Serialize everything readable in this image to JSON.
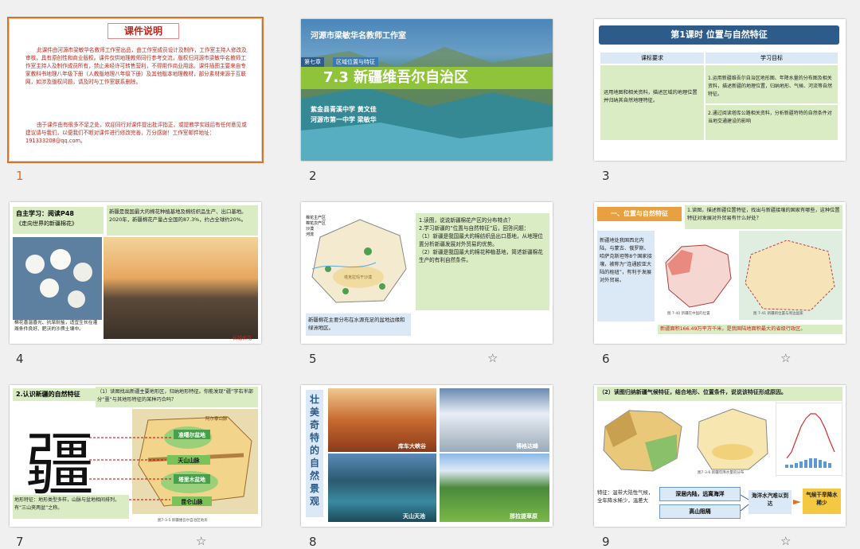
{
  "slides": [
    {
      "number": "1",
      "title": "课件说明",
      "body1": "此课件由河源市梁敏华名教师工作室出品，由工作室成员设计及制作，工作室主持人修改及审核，具有原创性和商业版权。课件仅供地理教师同行参考交流，版权归河源市梁敏华名教师工作室主持人及制作成员所有，禁止未经许可转售营利，不得用作商业用途。课件插图主要来自专家教科书地理八年级下册（人教版地理八年级下册）及其他版本地理教材，部分素材来源于互联网，如涉及版权问题，请及时与工作室联系删除。",
      "body2": "由于课件由有很多不足之处，欢迎同行对课件提出批评指正，或提教学实践后有任何意见或建议请与我们，以便我们不断对课件进行修改完善，万分感谢！工作室邮件地址：191333208@qq.com。"
    },
    {
      "number": "2",
      "studio": "河源市梁敏华名教师工作室",
      "chapter": "第七章",
      "section": "区域位置与特征",
      "title": "7.3 新疆维吾尔自治区",
      "author1": "紫金县青溪中学  黄文佳",
      "author2": "河源市第一中学  梁敏华"
    },
    {
      "number": "3",
      "header": "第1课时   位置与自然特征",
      "col1": "课标要求",
      "col2": "学习目标",
      "req": "运用地图和相关资料，描述区域的地理位置并归纳其自然地理特征。",
      "goal1": "1.运用新疆维吾尔自治区地形图、年降水量的分布图及相关资料，描述新疆的地理位置，归纳地形、气候、河流等自然特征。",
      "goal2": "2.通过阅读塔库公路相关资料，分析新疆特特的自然条件对当地交通建设的影响"
    },
    {
      "number": "4",
      "label1": "自主学习：阅读P48",
      "label2": "《走向世界的新疆棉花》",
      "text": "新疆是我国最大的棉花种植基地及棉纺织品生产、出口基地。2020年，新疆棉花产量占全国的87.3%，约占全球约20%。",
      "caption": "棉花喜温喜光、抗旱耐盐，适宜生长在灌溉条件良好、肥沃的沙质土壤中。",
      "tag": "长绒棉花"
    },
    {
      "number": "5",
      "q1": "1.读图，说说新疆棉花产区的分布特点？",
      "q2": "2.学习新疆的“位置与自然特征”后，回答问题：",
      "q3": "（1）新疆是我国最大的棉纺织品出口基地，从地理位置分析新疆发展对外贸易的优势。",
      "q4": "（2）新疆是我国最大的棉花种植基地，简述新疆棉花生产的有利自然条件。",
      "answer": "新疆棉花主要分布在水源充足的盆地边缘和绿洲地区。",
      "legend": [
        "棉花主产区",
        "棉花次产区",
        "沙漠",
        "河流"
      ],
      "map_label": "塔克拉玛干沙漠"
    },
    {
      "number": "6",
      "badge": "一、位置与自然特征",
      "q": "1.读图，描述新疆位置特征，找出与新疆接壤的国家有哪些，这种位置特征对发展对外贸易有什么好处？",
      "side": "新疆地处我国西北内陆，与蒙古、俄罗斯、哈萨克斯坦等8个国家接壤，被称为“连通欧亚大陆的枢纽”，有利于发展对外贸易。",
      "area": "新疆面积166.49万平方千米，是我国陆地面积最大的省级行政区。",
      "cap1": "图 7-40 新疆在中国的位置",
      "cap2": "图 7-41 新疆的位置与周边国家"
    },
    {
      "number": "7",
      "head": "2.认识新疆的自然特征",
      "q": "（1）读图找出新疆主要地形区，归纳地形特征。你能发现“疆”字右半部分“畺”与其地形特征的某种巧合吗？",
      "char": "疆",
      "l1": "准噶尔盆地",
      "l2": "天山山脉",
      "l3": "塔里木盆地",
      "l4": "昆仑山脉",
      "mt": "阿尔泰山脉",
      "feat": "地形特征：地形类型多样，山脉与盆地相间排列，有“三山夹两盆”之称。",
      "cap": "图7-3-5 新疆维吾尔自治区地形"
    },
    {
      "number": "8",
      "vtitle": "壮美奇特的自然景观",
      "p1": "库车大峡谷",
      "p2": "博格达峰",
      "p3": "天山天池",
      "p4": "那拉提草原"
    },
    {
      "number": "9",
      "q": "（2）读图归纳新疆气候特征，结合地形、位置条件，说说该特征形成原因。",
      "trait": "特征：温带大陆性气候，全年降水稀少，温差大",
      "b1": "深居内陆，远离海洋",
      "b2": "高山阻隔",
      "b3": "海洋水汽难以到达",
      "b4": "气候干旱降水稀少",
      "cap": "图7-3-6 新疆年降水量的分布"
    }
  ],
  "colors": {
    "accent": "#e07020",
    "green": "#d9ecc4",
    "blue": "#2e5c8a"
  }
}
